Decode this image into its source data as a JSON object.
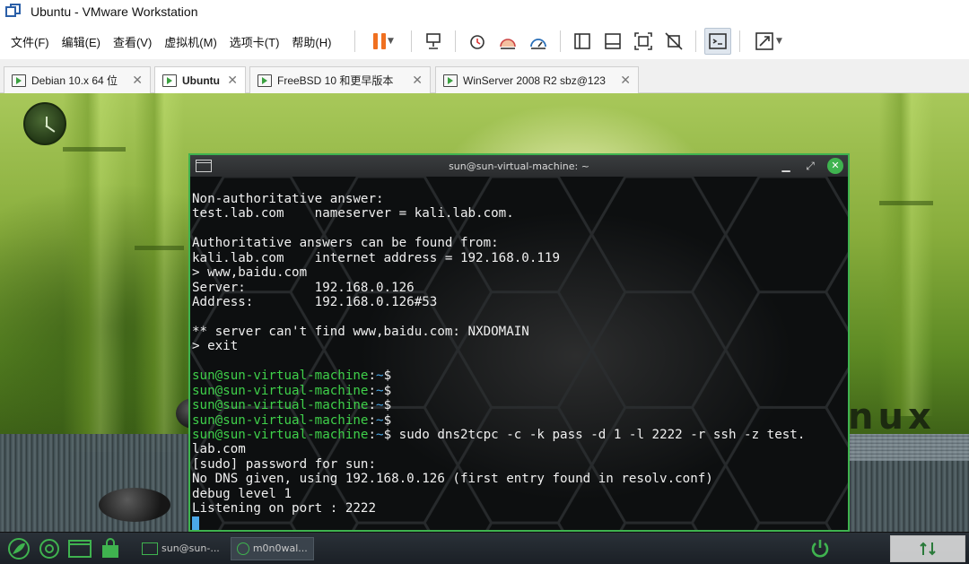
{
  "window": {
    "title": "Ubuntu - VMware Workstation"
  },
  "menu": [
    {
      "id": "file",
      "label": "文件(F)"
    },
    {
      "id": "edit",
      "label": "编辑(E)"
    },
    {
      "id": "view",
      "label": "查看(V)"
    },
    {
      "id": "vm",
      "label": "虚拟机(M)"
    },
    {
      "id": "tabs",
      "label": "选项卡(T)"
    },
    {
      "id": "help",
      "label": "帮助(H)"
    }
  ],
  "toolbar": {
    "icons": [
      "pause-icon",
      "send-ctrl-alt-del-icon",
      "snapshot-icon",
      "revert-snapshot-icon",
      "snapshot-manager-icon",
      "library-icon",
      "thumbnail-icon",
      "fullscreen-icon",
      "unity-icon",
      "console-view-icon",
      "stretch-icon"
    ]
  },
  "tabs": [
    {
      "label": "Debian 10.x 64 位",
      "active": false
    },
    {
      "label": "Ubuntu",
      "active": true
    },
    {
      "label": "FreeBSD 10 和更早版本",
      "active": false
    },
    {
      "label": "WinServer 2008 R2 sbz@123",
      "active": false
    }
  ],
  "desktop": {
    "brand_text": "nux"
  },
  "terminal": {
    "title": "sun@sun-virtual-machine: ~",
    "prompt_user": "sun@sun-virtual-machine",
    "prompt_path": "~",
    "lines": [
      {
        "type": "out",
        "text": "Non-authoritative answer:"
      },
      {
        "type": "out",
        "text": "test.lab.com    nameserver = kali.lab.com."
      },
      {
        "type": "out",
        "text": ""
      },
      {
        "type": "out",
        "text": "Authoritative answers can be found from:"
      },
      {
        "type": "out",
        "text": "kali.lab.com    internet address = 192.168.0.119"
      },
      {
        "type": "out",
        "text": "> www,baidu.com"
      },
      {
        "type": "out",
        "text": "Server:         192.168.0.126"
      },
      {
        "type": "out",
        "text": "Address:        192.168.0.126#53"
      },
      {
        "type": "out",
        "text": ""
      },
      {
        "type": "out",
        "text": "** server can't find www,baidu.com: NXDOMAIN"
      },
      {
        "type": "out",
        "text": "> exit"
      },
      {
        "type": "out",
        "text": ""
      },
      {
        "type": "prompt",
        "text": ""
      },
      {
        "type": "prompt",
        "text": ""
      },
      {
        "type": "prompt",
        "text": ""
      },
      {
        "type": "prompt",
        "text": ""
      },
      {
        "type": "prompt",
        "text": " sudo dns2tcpc -c -k pass -d 1 -l 2222 -r ssh -z test."
      },
      {
        "type": "out",
        "text": "lab.com"
      },
      {
        "type": "out",
        "text": "[sudo] password for sun:"
      },
      {
        "type": "out",
        "text": "No DNS given, using 192.168.0.126 (first entry found in resolv.conf)"
      },
      {
        "type": "out",
        "text": "debug level 1"
      },
      {
        "type": "out",
        "text": "Listening on port : 2222"
      },
      {
        "type": "cursor",
        "text": ""
      }
    ]
  },
  "taskbar": {
    "items": [
      {
        "label": "sun@sun-...",
        "active": false
      },
      {
        "label": "m0n0wal...",
        "active": true
      }
    ]
  }
}
